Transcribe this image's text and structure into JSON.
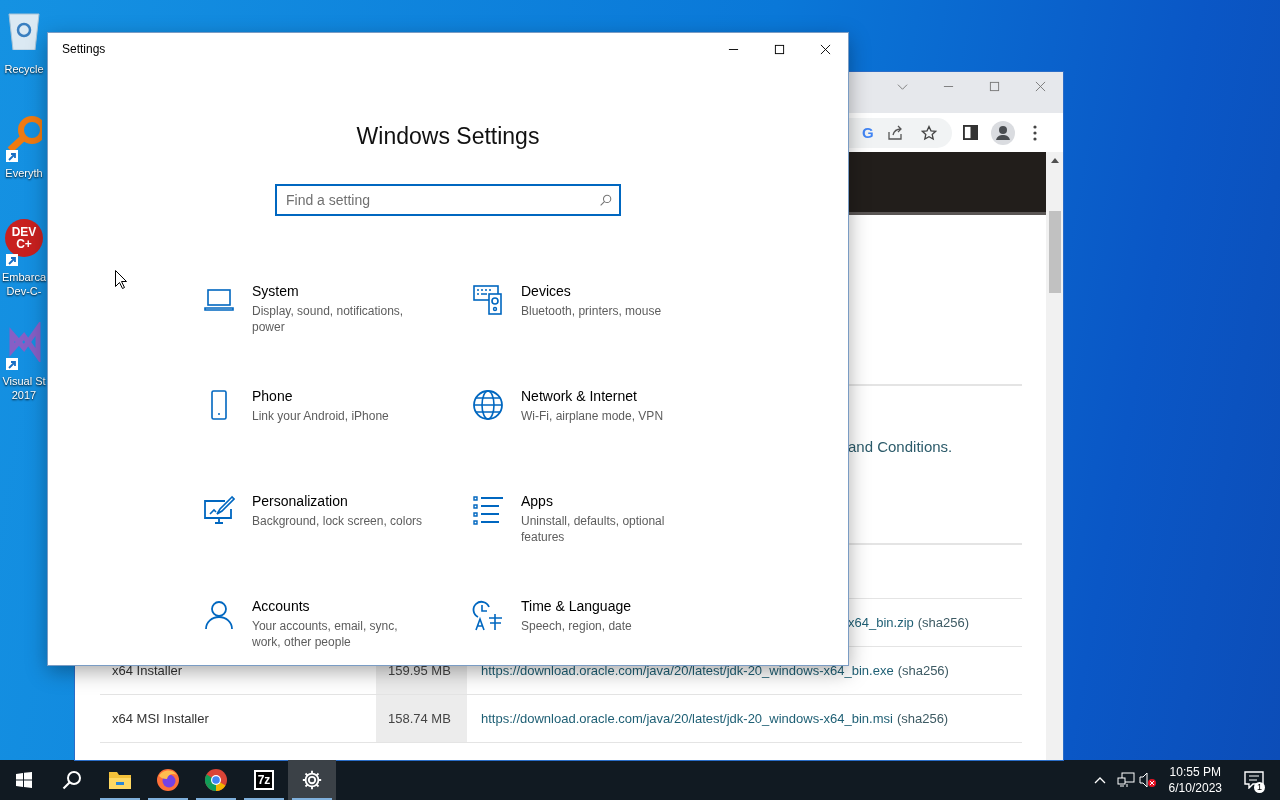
{
  "desktop_icons": [
    {
      "kind": "recycle-bin",
      "label_lines": [
        "Recycle"
      ],
      "shortcut": false
    },
    {
      "kind": "magnifier",
      "label_lines": [
        "Everyth"
      ],
      "shortcut": true
    },
    {
      "kind": "dev-logo",
      "logo_lines": [
        "DEV",
        "C+"
      ],
      "label_lines": [
        "Embarca",
        "Dev-C-"
      ],
      "shortcut": true
    },
    {
      "kind": "vs-logo",
      "label_lines": [
        "Visual St",
        "2017"
      ],
      "shortcut": true
    }
  ],
  "browser_window": {
    "toolbar": {
      "lens_badge": "G"
    },
    "page": {
      "notice_fragment": "and Conditions.",
      "rows": [
        {
          "label": "",
          "size": "",
          "link": "x64_bin.zip",
          "checksum": "(sha256)",
          "partial": true
        },
        {
          "label": "x64 Installer",
          "size": "159.95 MB",
          "link": "https://download.oracle.com/java/20/latest/jdk-20_windows-x64_bin.exe",
          "checksum": "(sha256)",
          "partial": false
        },
        {
          "label": "x64 MSI Installer",
          "size": "158.74 MB",
          "link": "https://download.oracle.com/java/20/latest/jdk-20_windows-x64_bin.msi",
          "checksum": "(sha256)",
          "partial": false
        }
      ]
    }
  },
  "settings_window": {
    "title": "Settings",
    "heading": "Windows Settings",
    "search": {
      "placeholder": "Find a setting"
    },
    "categories": [
      {
        "kind": "system",
        "name": "System",
        "description": "Display, sound, notifications, power"
      },
      {
        "kind": "devices",
        "name": "Devices",
        "description": "Bluetooth, printers, mouse"
      },
      {
        "kind": "phone",
        "name": "Phone",
        "description": "Link your Android, iPhone"
      },
      {
        "kind": "network",
        "name": "Network & Internet",
        "description": "Wi-Fi, airplane mode, VPN"
      },
      {
        "kind": "personalization",
        "name": "Personalization",
        "description": "Background, lock screen, colors"
      },
      {
        "kind": "apps",
        "name": "Apps",
        "description": "Uninstall, defaults, optional features"
      },
      {
        "kind": "accounts",
        "name": "Accounts",
        "description": "Your accounts, email, sync, work, other people"
      },
      {
        "kind": "time",
        "name": "Time & Language",
        "description": "Speech, region, date"
      }
    ]
  },
  "taskbar": {
    "apps": [
      {
        "kind": "explorer",
        "running": true,
        "selected": false
      },
      {
        "kind": "firefox",
        "running": true,
        "selected": false
      },
      {
        "kind": "chrome",
        "running": true,
        "selected": false
      },
      {
        "kind": "sevenzip",
        "badge_text": "7z",
        "running": true,
        "selected": false
      },
      {
        "kind": "settings",
        "running": true,
        "selected": true
      }
    ],
    "time": "10:55 PM",
    "date": "6/10/2023",
    "notification_count": "1"
  }
}
